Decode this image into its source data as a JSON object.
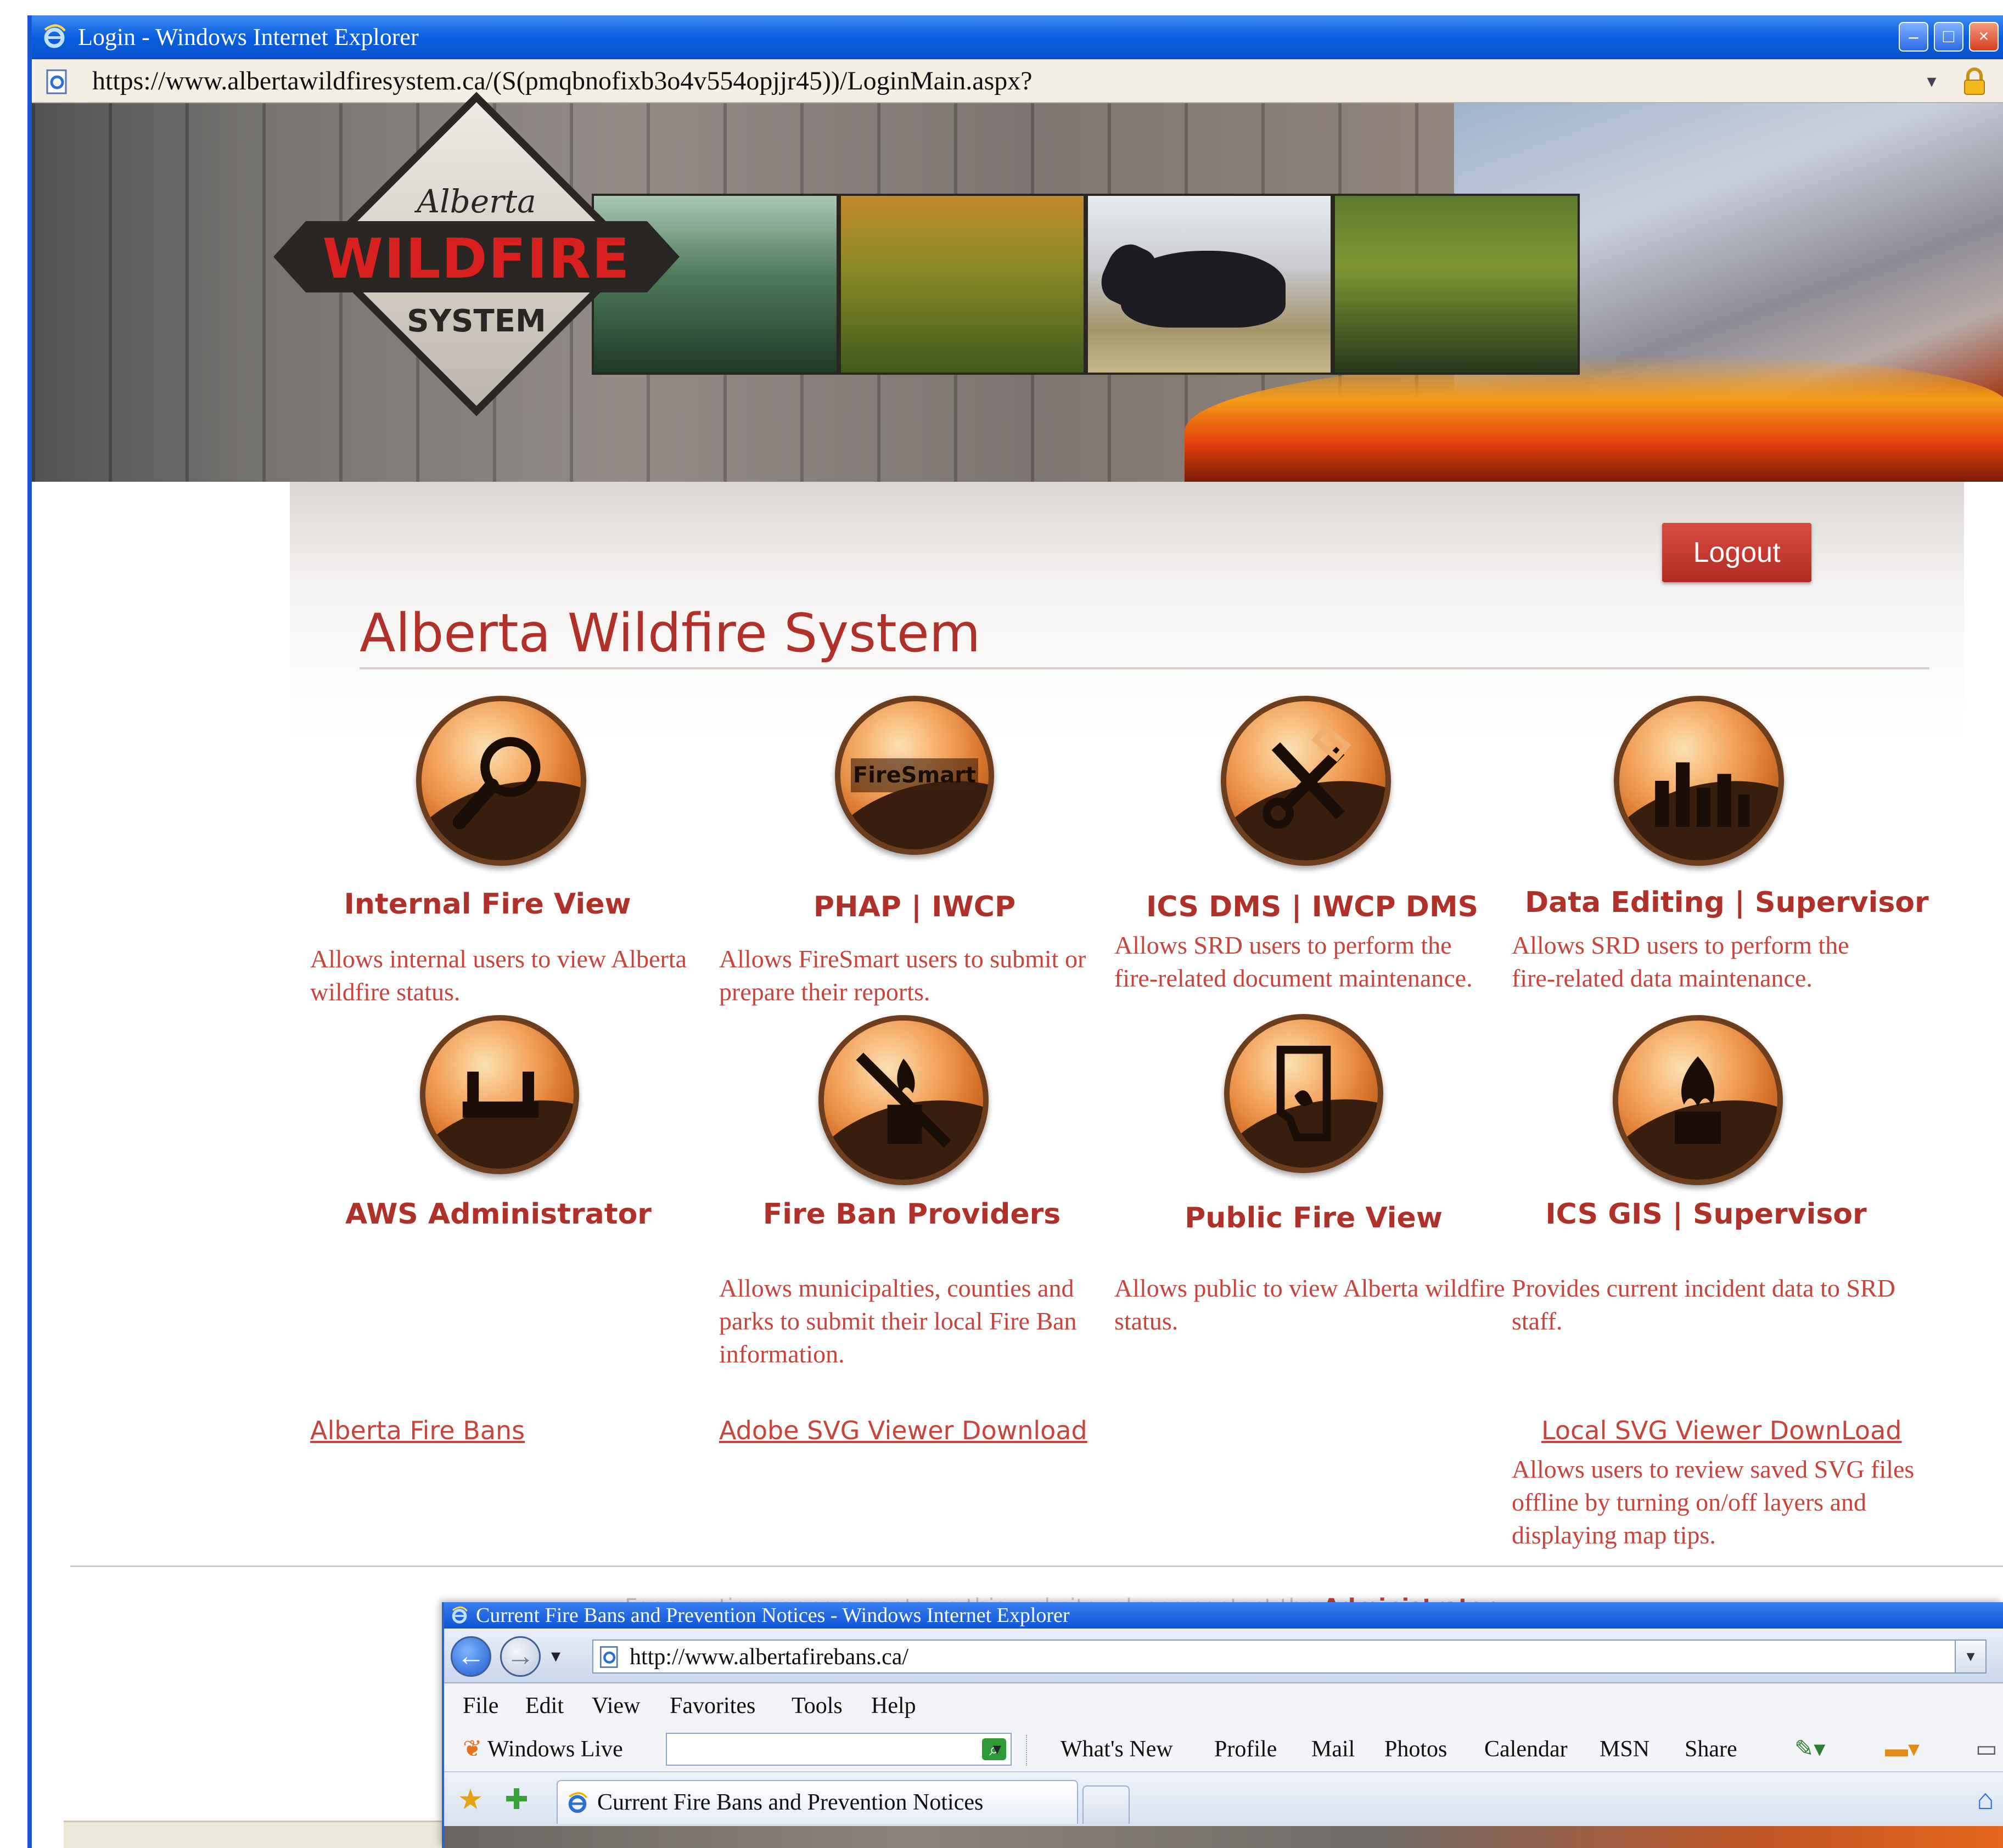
{
  "back_window": {
    "title": "Login - Windows Internet Explorer",
    "url": "https://www.albertawildfiresystem.ca/(S(pmqbnofixb3o4v554opjjr45))/LoginMain.aspx?",
    "buttons": {
      "minimize": "–",
      "maximize": "□",
      "close": "×"
    }
  },
  "logo": {
    "top": "Alberta",
    "main": "WILDFIRE",
    "sub": "SYSTEM"
  },
  "page": {
    "logout_label": "Logout",
    "title": "Alberta Wildfire System",
    "tiles": [
      {
        "title": "Internal Fire View",
        "description": "Allows internal users to view Alberta wildfire status.",
        "icon": "magnifier-icon"
      },
      {
        "title": "PHAP | IWCP",
        "description": "Allows FireSmart users to submit or prepare their reports.",
        "icon": "firesmart-icon",
        "icon_text": "FireSmart"
      },
      {
        "title": "ICS DMS | IWCP DMS",
        "description": "Allows SRD users to perform the fire-related document maintenance.",
        "icon": "tools-icon"
      },
      {
        "title": "Data Editing | Supervisor",
        "description": "Allows SRD users to perform the fire-related data maintenance.",
        "icon": "bar-chart-icon"
      },
      {
        "title": "AWS Administrator",
        "description": "",
        "icon": "admin-icon"
      },
      {
        "title": "Fire Ban Providers",
        "description": "Allows municipalties, counties and parks to submit their local Fire Ban information.",
        "icon": "fire-ban-icon"
      },
      {
        "title": "Public Fire View",
        "description": "Allows public to view Alberta wildfire status.",
        "icon": "alberta-map-icon"
      },
      {
        "title": "ICS GIS | Supervisor",
        "description": "Provides current incident data to SRD staff.",
        "icon": "fire-icon"
      }
    ],
    "links": {
      "fire_bans": "Alberta Fire Bans",
      "adobe_svg": "Adobe SVG Viewer Download",
      "local_svg": "Local SVG Viewer DownLoad",
      "local_svg_desc": "Allows users to review saved SVG files offline by turning on/off layers and displaying map tips."
    },
    "footer": {
      "text": "For questions or comments on this website, please contact the ",
      "admin_link": "Administrator"
    }
  },
  "front_window": {
    "title": "Current Fire Bans and Prevention Notices - Windows Internet Explorer",
    "url": "http://www.albertafirebans.ca/",
    "menu": [
      "File",
      "Edit",
      "View",
      "Favorites",
      "Tools",
      "Help"
    ],
    "live": {
      "brand": "Windows Live",
      "search_placeholder": "",
      "links": [
        "What's New",
        "Profile",
        "Mail",
        "Photos",
        "Calendar",
        "MSN",
        "Share"
      ]
    },
    "tab_title": "Current Fire Bans and Prevention Notices"
  },
  "colors": {
    "accent_red": "#b0302a",
    "link_red": "#c8443c",
    "xp_blue": "#0a5ee0",
    "icon_orange": "#d9752c"
  }
}
